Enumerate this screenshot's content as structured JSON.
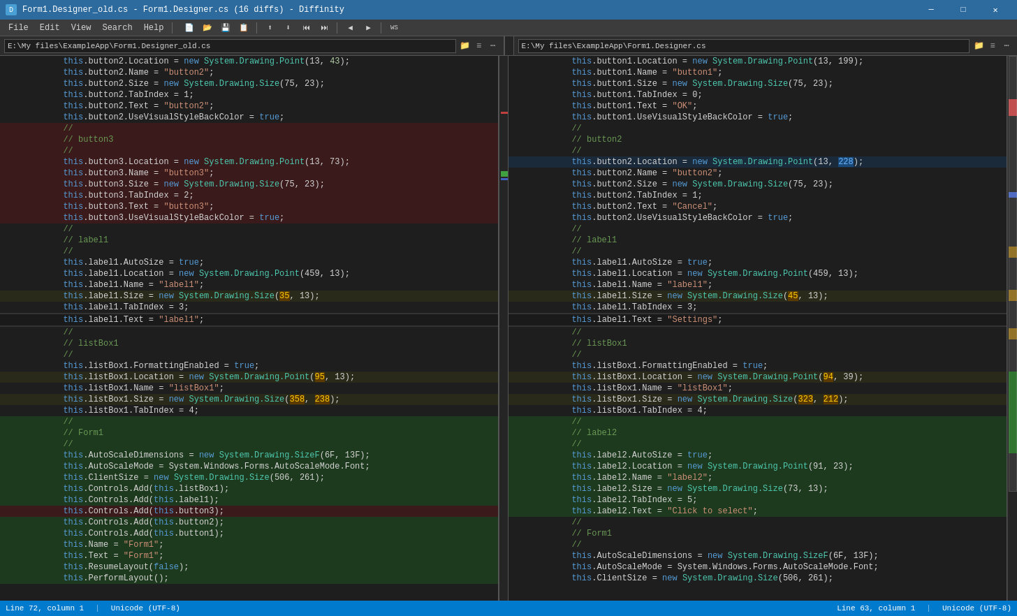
{
  "titleBar": {
    "title": "Form1.Designer_old.cs - Form1.Designer.cs (16 diffs) - Diffinity",
    "iconText": "D",
    "minimizeLabel": "─",
    "maximizeLabel": "□",
    "closeLabel": "✕"
  },
  "menuBar": {
    "items": [
      "File",
      "Edit",
      "View",
      "Search",
      "Help"
    ]
  },
  "leftPane": {
    "path": "E:\\My files\\ExampleApp\\Form1.Designer_old.cs",
    "statusLine": "Line 72, column 1",
    "statusEncoding": "Unicode (UTF-8)"
  },
  "rightPane": {
    "path": "E:\\My files\\ExampleApp\\Form1.Designer.cs",
    "statusLine": "Line 63, column 1",
    "statusEncoding": "Unicode (UTF-8)"
  },
  "leftLines": [
    {
      "num": "",
      "text": "            this.button2.Location = new System.Drawing.Point(13, 43);",
      "type": "normal"
    },
    {
      "num": "",
      "text": "            this.button2.Name = \"button2\";",
      "type": "normal"
    },
    {
      "num": "",
      "text": "            this.button2.Size = new System.Drawing.Size(75, 23);",
      "type": "normal"
    },
    {
      "num": "",
      "text": "            this.button2.TabIndex = 1;",
      "type": "normal"
    },
    {
      "num": "",
      "text": "            this.button2.Text = \"button2\";",
      "type": "normal"
    },
    {
      "num": "",
      "text": "            this.button2.UseVisualStyleBackColor = true;",
      "type": "normal"
    },
    {
      "num": "",
      "text": "            //",
      "type": "removed"
    },
    {
      "num": "",
      "text": "            // button3",
      "type": "removed"
    },
    {
      "num": "",
      "text": "            //",
      "type": "removed"
    },
    {
      "num": "",
      "text": "            this.button3.Location = new System.Drawing.Point(13, 73);",
      "type": "removed"
    },
    {
      "num": "",
      "text": "            this.button3.Name = \"button3\";",
      "type": "removed"
    },
    {
      "num": "",
      "text": "            this.button3.Size = new System.Drawing.Size(75, 23);",
      "type": "removed"
    },
    {
      "num": "",
      "text": "            this.button3.TabIndex = 2;",
      "type": "removed"
    },
    {
      "num": "",
      "text": "            this.button3.Text = \"button3\";",
      "type": "removed"
    },
    {
      "num": "",
      "text": "            this.button3.UseVisualStyleBackColor = true;",
      "type": "removed"
    },
    {
      "num": "",
      "text": "            //",
      "type": "normal"
    },
    {
      "num": "",
      "text": "            // label1",
      "type": "normal"
    },
    {
      "num": "",
      "text": "            //",
      "type": "normal"
    },
    {
      "num": "",
      "text": "            this.label1.AutoSize = true;",
      "type": "normal"
    },
    {
      "num": "",
      "text": "            this.label1.Location = new System.Drawing.Point(459, 13);",
      "type": "normal"
    },
    {
      "num": "",
      "text": "            this.label1.Name = \"label1\";",
      "type": "normal"
    },
    {
      "num": "",
      "text": "            this.label1.Size = new System.Drawing.Size(35, 13);",
      "type": "changed"
    },
    {
      "num": "",
      "text": "            this.label1.TabIndex = 3;",
      "type": "normal"
    },
    {
      "num": "",
      "text": "            this.label1.Text = \"label1\";",
      "type": "changed-dark"
    },
    {
      "num": "",
      "text": "            //",
      "type": "normal"
    },
    {
      "num": "",
      "text": "            // listBox1",
      "type": "normal"
    },
    {
      "num": "",
      "text": "            //",
      "type": "normal"
    },
    {
      "num": "",
      "text": "            this.listBox1.FormattingEnabled = true;",
      "type": "normal"
    },
    {
      "num": "",
      "text": "            this.listBox1.Location = new System.Drawing.Point(95, 13);",
      "type": "changed"
    },
    {
      "num": "",
      "text": "            this.listBox1.Name = \"listBox1\";",
      "type": "normal"
    },
    {
      "num": "",
      "text": "            this.listBox1.Size = new System.Drawing.Size(358, 238);",
      "type": "changed"
    },
    {
      "num": "",
      "text": "            this.listBox1.TabIndex = 4;",
      "type": "normal"
    },
    {
      "num": "",
      "text": "            //",
      "type": "green"
    },
    {
      "num": "",
      "text": "            // Form1",
      "type": "green"
    },
    {
      "num": "",
      "text": "            //",
      "type": "green"
    },
    {
      "num": "",
      "text": "            this.AutoScaleDimensions = new System.Drawing.SizeF(6F, 13F);",
      "type": "green"
    },
    {
      "num": "",
      "text": "            this.AutoScaleMode = System.Windows.Forms.AutoScaleMode.Font;",
      "type": "green"
    },
    {
      "num": "",
      "text": "            this.ClientSize = new System.Drawing.Size(506, 261);",
      "type": "green"
    },
    {
      "num": "",
      "text": "            this.Controls.Add(this.listBox1);",
      "type": "green"
    },
    {
      "num": "",
      "text": "            this.Controls.Add(this.label1);",
      "type": "green"
    },
    {
      "num": "",
      "text": "            this.Controls.Add(this.button3);",
      "type": "removed-line"
    },
    {
      "num": "",
      "text": "            this.Controls.Add(this.button2);",
      "type": "green"
    },
    {
      "num": "",
      "text": "            this.Controls.Add(this.button1);",
      "type": "green"
    },
    {
      "num": "",
      "text": "            this.Name = \"Form1\";",
      "type": "green"
    },
    {
      "num": "",
      "text": "            this.Text = \"Form1\";",
      "type": "green"
    },
    {
      "num": "",
      "text": "            this.ResumeLayout(false);",
      "type": "green"
    },
    {
      "num": "",
      "text": "            this.PerformLayout();",
      "type": "green"
    }
  ],
  "rightLines": [
    {
      "num": "",
      "text": "            this.button1.Location = new System.Drawing.Point(13, 199);",
      "type": "normal"
    },
    {
      "num": "",
      "text": "            this.button1.Name = \"button1\";",
      "type": "normal"
    },
    {
      "num": "",
      "text": "            this.button1.Size = new System.Drawing.Size(75, 23);",
      "type": "normal"
    },
    {
      "num": "",
      "text": "            this.button1.TabIndex = 0;",
      "type": "normal"
    },
    {
      "num": "",
      "text": "            this.button1.Text = \"OK\";",
      "type": "normal"
    },
    {
      "num": "",
      "text": "            this.button1.UseVisualStyleBackColor = true;",
      "type": "normal"
    },
    {
      "num": "",
      "text": "            //",
      "type": "normal"
    },
    {
      "num": "",
      "text": "            // button2",
      "type": "normal"
    },
    {
      "num": "",
      "text": "            //",
      "type": "normal"
    },
    {
      "num": "",
      "text": "            this.button2.Location = new System.Drawing.Point(13, 228);",
      "type": "changed-blue"
    },
    {
      "num": "",
      "text": "            this.button2.Name = \"button2\";",
      "type": "normal"
    },
    {
      "num": "",
      "text": "            this.button2.Size = new System.Drawing.Size(75, 23);",
      "type": "normal"
    },
    {
      "num": "",
      "text": "            this.button2.TabIndex = 1;",
      "type": "normal"
    },
    {
      "num": "",
      "text": "            this.button2.Text = \"Cancel\";",
      "type": "normal"
    },
    {
      "num": "",
      "text": "            this.button2.UseVisualStyleBackColor = true;",
      "type": "normal"
    },
    {
      "num": "",
      "text": "            //",
      "type": "normal"
    },
    {
      "num": "",
      "text": "            // label1",
      "type": "normal"
    },
    {
      "num": "",
      "text": "            //",
      "type": "normal"
    },
    {
      "num": "",
      "text": "            this.label1.AutoSize = true;",
      "type": "normal"
    },
    {
      "num": "",
      "text": "            this.label1.Location = new System.Drawing.Point(459, 13);",
      "type": "normal"
    },
    {
      "num": "",
      "text": "            this.label1.Name = \"label1\";",
      "type": "normal"
    },
    {
      "num": "",
      "text": "            this.label1.Size = new System.Drawing.Size(45, 13);",
      "type": "changed"
    },
    {
      "num": "",
      "text": "            this.label1.TabIndex = 3;",
      "type": "normal"
    },
    {
      "num": "",
      "text": "            this.label1.Text = \"Settings\";",
      "type": "changed-dark"
    },
    {
      "num": "",
      "text": "            //",
      "type": "normal"
    },
    {
      "num": "",
      "text": "            // listBox1",
      "type": "normal"
    },
    {
      "num": "",
      "text": "            //",
      "type": "normal"
    },
    {
      "num": "",
      "text": "            this.listBox1.FormattingEnabled = true;",
      "type": "normal"
    },
    {
      "num": "",
      "text": "            this.listBox1.Location = new System.Drawing.Point(94, 39);",
      "type": "changed"
    },
    {
      "num": "",
      "text": "            this.listBox1.Name = \"listBox1\";",
      "type": "normal"
    },
    {
      "num": "",
      "text": "            this.listBox1.Size = new System.Drawing.Size(323, 212);",
      "type": "changed"
    },
    {
      "num": "",
      "text": "            this.listBox1.TabIndex = 4;",
      "type": "normal"
    },
    {
      "num": "",
      "text": "            //",
      "type": "green"
    },
    {
      "num": "",
      "text": "            // label2",
      "type": "green"
    },
    {
      "num": "",
      "text": "            //",
      "type": "green"
    },
    {
      "num": "",
      "text": "            this.label2.AutoSize = true;",
      "type": "green"
    },
    {
      "num": "",
      "text": "            this.label2.Location = new System.Drawing.Point(91, 23);",
      "type": "green"
    },
    {
      "num": "",
      "text": "            this.label2.Name = \"label2\";",
      "type": "green"
    },
    {
      "num": "",
      "text": "            this.label2.Size = new System.Drawing.Size(73, 13);",
      "type": "green"
    },
    {
      "num": "",
      "text": "            this.label2.TabIndex = 5;",
      "type": "green"
    },
    {
      "num": "",
      "text": "            this.label2.Text = \"Click to select\";",
      "type": "green"
    },
    {
      "num": "",
      "text": "            //",
      "type": "normal"
    },
    {
      "num": "",
      "text": "            // Form1",
      "type": "normal"
    },
    {
      "num": "",
      "text": "            //",
      "type": "normal"
    },
    {
      "num": "",
      "text": "            this.AutoScaleDimensions = new System.Drawing.SizeF(6F, 13F);",
      "type": "normal"
    },
    {
      "num": "",
      "text": "            this.AutoScaleMode = System.Windows.Forms.AutoScaleMode.Font;",
      "type": "normal"
    },
    {
      "num": "",
      "text": "            this.ClientSize = new System.Drawing.Size(506, 261);",
      "type": "normal"
    }
  ]
}
